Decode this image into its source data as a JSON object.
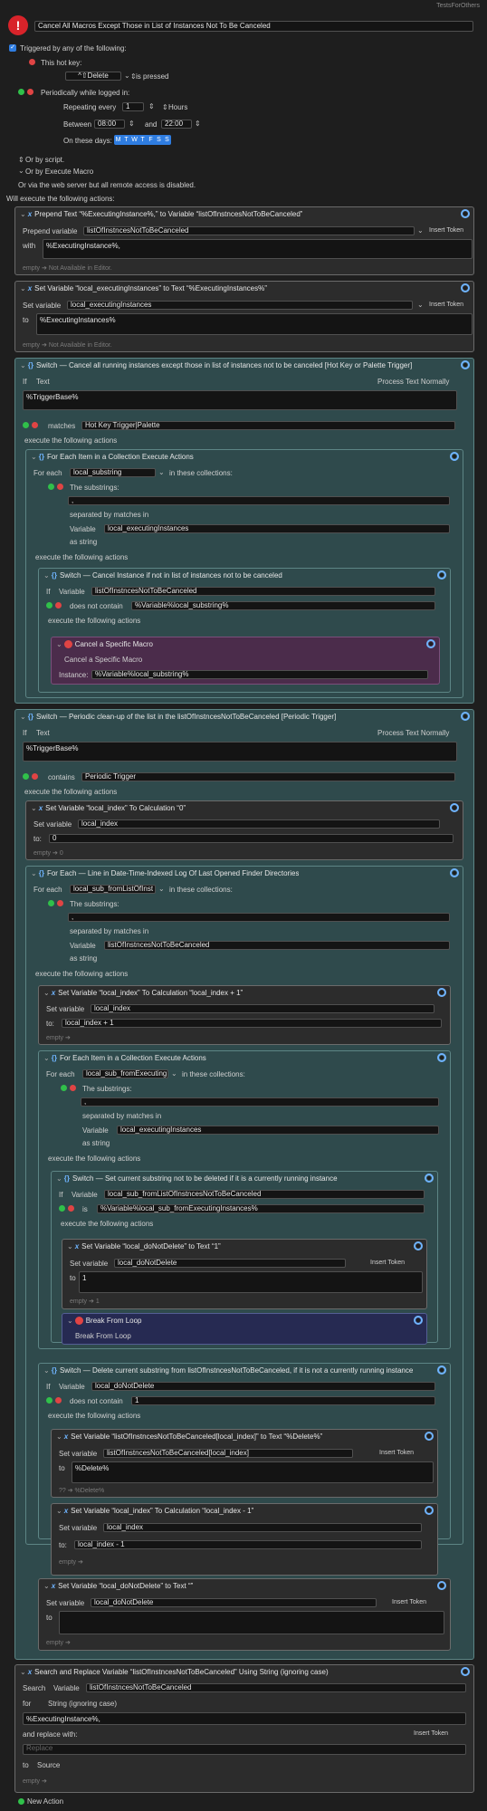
{
  "top_right": "TestsForOthers",
  "macro_name": "Cancel All Macros Except Those in List of Instances Not To Be Canceled",
  "trigger": {
    "label": "Triggered by any of the following:",
    "hotkey_label": "This hot key:",
    "hotkey_value": "^⇧Delete",
    "hotkey_mode": "is pressed",
    "periodic_label": "Periodically while logged in:",
    "repeat_label": "Repeating every",
    "repeat_value": "1",
    "repeat_unit": "Hours",
    "between_label": "Between",
    "start": "08:00",
    "and_label": "and",
    "end": "22:00",
    "days_label": "On these days:",
    "days": [
      "M",
      "T",
      "W",
      "T",
      "F",
      "S",
      "S"
    ],
    "or_script": "Or by script.",
    "or_execute": "Or by Execute Macro",
    "or_web": "Or via the web server but all remote access is disabled."
  },
  "will_execute": "Will execute the following actions:",
  "labels": {
    "prepend_variable": "Prepend variable",
    "with": "with",
    "set_variable": "Set variable",
    "to": "to",
    "to_colon": "to:",
    "if": "If",
    "text": "Text",
    "process_text": "Process Text Normally",
    "matches": "matches",
    "contains": "contains",
    "execute_actions": "execute the following actions",
    "for_each": "For each",
    "in_collections": "in these collections:",
    "substrings": "The substrings:",
    "separated": "separated by matches in",
    "variable": "Variable",
    "as_string": "as string",
    "does_not_contain": "does not contain",
    "is": "is",
    "instance": "Instance:",
    "insert_token": "Insert Token",
    "search": "Search",
    "for": "for",
    "string_ignoring": "String (ignoring case)",
    "replace_with": "and replace with:",
    "replace_placeholder": "Replace",
    "source": "Source",
    "new_action": "New Action"
  },
  "a1": {
    "title": "Prepend Text “%ExecutingInstance%,” to Variable “listOfInstncesNotToBeCanceled”",
    "variable": "listOfInstncesNotToBeCanceled",
    "with": "%ExecutingInstance%,",
    "footer": "empty ➔ Not Available in Editor."
  },
  "a2": {
    "title": "Set Variable “local_executingInstances” to Text “%ExecutingInstances%”",
    "variable": "local_executingInstances",
    "to": "%ExecutingInstances%",
    "footer": "empty ➔ Not Available in Editor."
  },
  "s1": {
    "title": "Switch — Cancel all running instances except those in list of instances not to be canceled [Hot Key or Palette Trigger]",
    "text": "%TriggerBase%",
    "match": "Hot Key Trigger|Palette"
  },
  "fe1": {
    "title": "For Each Item in a Collection Execute Actions",
    "var": "local_substring",
    "sep": ",",
    "coll_var": "local_executingInstances"
  },
  "s2": {
    "title": "Switch — Cancel Instance if not in list of instances not to be canceled",
    "var": "listOfInstncesNotToBeCanceled",
    "cond": "%Variable%local_substring%"
  },
  "cm": {
    "title": "Cancel a Specific Macro",
    "sub": "Cancel a Specific Macro",
    "instance": "%Variable%local_substring%"
  },
  "s3": {
    "title": "Switch — Periodic clean-up of the list in the listOfInstncesNotToBeCanceled [Periodic Trigger]",
    "text": "%TriggerBase%",
    "match": "Periodic Trigger"
  },
  "a3": {
    "title": "Set Variable “local_index” To Calculation “0”",
    "variable": "local_index",
    "to": "0",
    "footer": "empty ➔ 0"
  },
  "fe2": {
    "title": "For Each — Line in Date-Time-Indexed Log Of Last Opened Finder Directories",
    "var": "local_sub_fromListOfInst",
    "sep": ",",
    "coll_var": "listOfInstncesNotToBeCanceled"
  },
  "a4": {
    "title": "Set Variable “local_index” To Calculation “local_index + 1”",
    "variable": "local_index",
    "to": "local_index + 1",
    "footer": "empty ➔"
  },
  "fe3": {
    "title": "For Each Item in a Collection Execute Actions",
    "var": "local_sub_fromExecuting",
    "sep": ",",
    "coll_var": "local_executingInstances"
  },
  "s4": {
    "title": "Switch — Set current substring not to be deleted if it is a currently running instance",
    "var": "local_sub_fromListOfInstncesNotToBeCanceled",
    "cond": "%Variable%local_sub_fromExecutingInstances%"
  },
  "a5": {
    "title": "Set Variable “local_doNotDelete” to Text “1”",
    "variable": "local_doNotDelete",
    "to": "1",
    "footer": "empty ➔ 1"
  },
  "bl": {
    "title": "Break From Loop",
    "sub": "Break From Loop"
  },
  "s5": {
    "title": "Switch — Delete current substring from listOfInstncesNotToBeCanceled, if it is not a currently running instance",
    "var": "local_doNotDelete",
    "cond": "1"
  },
  "a6": {
    "title": "Set Variable “listOfInstncesNotToBeCanceled[local_index]” to Text “%Delete%”",
    "variable": "listOfInstncesNotToBeCanceled[local_index]",
    "to": "%Delete%",
    "footer": "?? ➔ %Delete%"
  },
  "a7": {
    "title": "Set Variable “local_index” To Calculation “local_index - 1”",
    "variable": "local_index",
    "to": "local_index - 1",
    "footer": "empty ➔"
  },
  "a8": {
    "title": "Set Variable “local_doNotDelete” to Text “”",
    "variable": "local_doNotDelete",
    "to": "",
    "footer": "empty ➔"
  },
  "a9": {
    "title": "Search and Replace Variable “listOfInstncesNotToBeCanceled” Using String (ignoring case)",
    "variable": "listOfInstncesNotToBeCanceled",
    "for_text": "%ExecutingInstance%,",
    "footer": "empty ➔"
  },
  "colors": {
    "switch_bg": "#2f4a4c",
    "action_bg": "#2c2c2c",
    "cancel_bg": "#4b2c4b",
    "break_bg": "#262a52",
    "accent": "#2f7de1"
  }
}
